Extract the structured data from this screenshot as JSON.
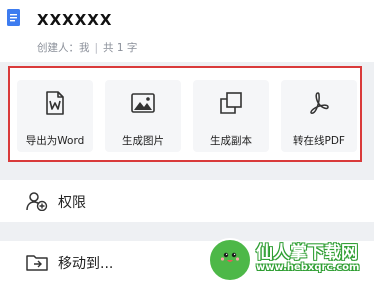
{
  "document": {
    "title": "XXXXXX",
    "creator_label": "创建人：我",
    "word_count": "共 1 字"
  },
  "actions": [
    {
      "label": "导出为Word",
      "icon": "word-file-icon"
    },
    {
      "label": "生成图片",
      "icon": "image-icon"
    },
    {
      "label": "生成副本",
      "icon": "copy-icon"
    },
    {
      "label": "转在线PDF",
      "icon": "pdf-icon"
    }
  ],
  "menu": [
    {
      "label": "权限",
      "icon": "user-add-icon"
    },
    {
      "label": "移动到...",
      "icon": "folder-move-icon"
    }
  ],
  "watermark": {
    "title": "仙人掌下载网",
    "url": "www.hebxqrc.com"
  },
  "colors": {
    "highlight_border": "#d93a3a",
    "doc_icon": "#3d7cf0",
    "watermark_green": "#4db848"
  }
}
